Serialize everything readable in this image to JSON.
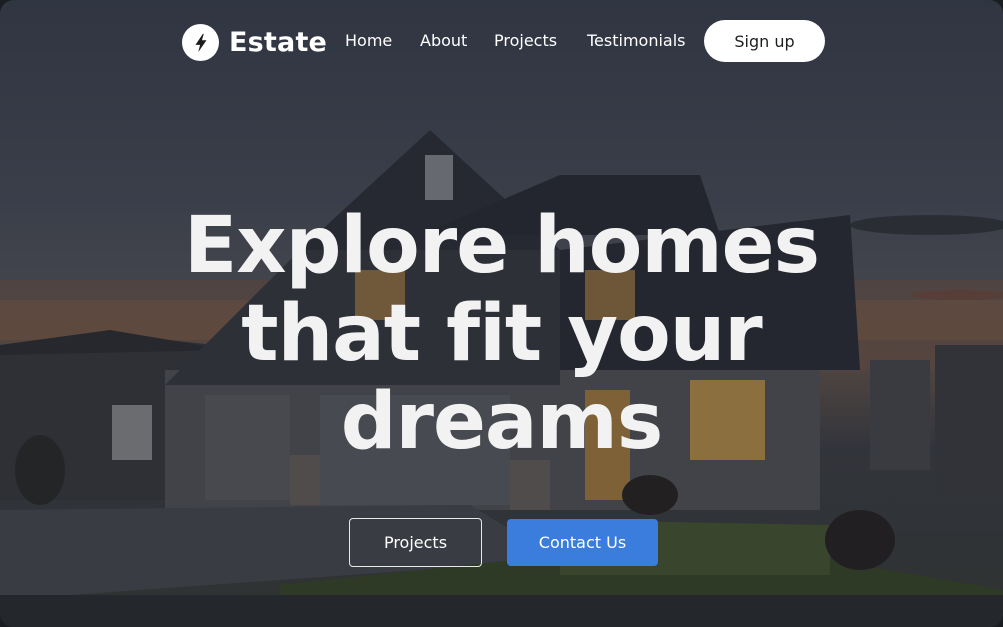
{
  "brand": {
    "name": "Estate",
    "logo_icon": "lightning-bolt-icon"
  },
  "nav": {
    "links": [
      {
        "label": "Home"
      },
      {
        "label": "About"
      },
      {
        "label": "Projects"
      },
      {
        "label": "Testimonials"
      }
    ],
    "signup_label": "Sign up"
  },
  "hero": {
    "headline_lines": [
      "Explore homes",
      "that fit your",
      "dreams"
    ],
    "buttons": {
      "projects_label": "Projects",
      "contact_label": "Contact Us"
    }
  },
  "colors": {
    "accent": "#3b7ddd",
    "text": "#ffffff",
    "signup_bg": "#ffffff"
  }
}
